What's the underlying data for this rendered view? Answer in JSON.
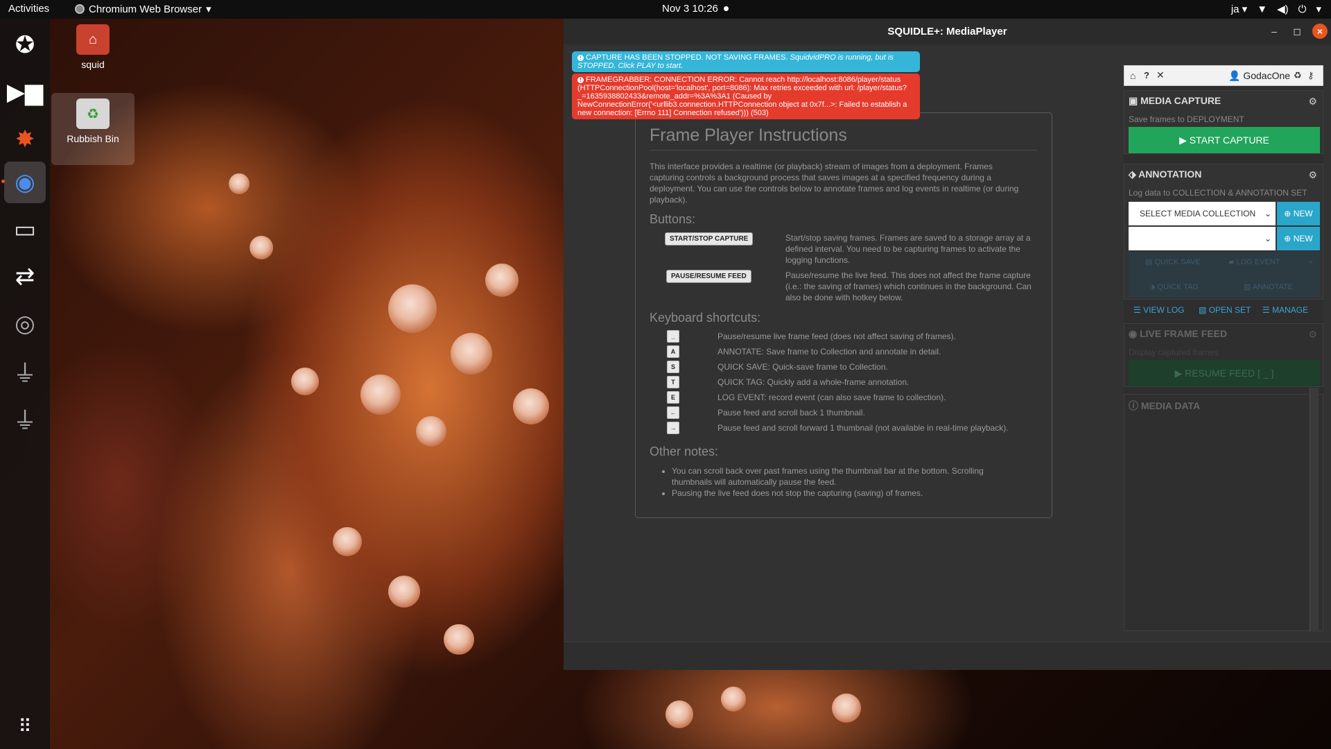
{
  "topbar": {
    "activities": "Activities",
    "app_name": "Chromium Web Browser",
    "clock": "Nov 3  10:26",
    "lang": "ja"
  },
  "desktop": {
    "icons": [
      {
        "label": "squid"
      },
      {
        "label": "Rubbish Bin"
      }
    ]
  },
  "window": {
    "title": "SQUIDLE+: MediaPlayer"
  },
  "alerts": {
    "info_main": "CAPTURE HAS BEEN STOPPED. NOT SAVING FRAMES.",
    "info_italic": "SquidvidPRO is running, but is STOPPED. Click PLAY to start.",
    "danger_text": "FRAMEGRABBER: CONNECTION ERROR: Cannot reach http://localhost:8086/player/status (HTTPConnectionPool(host='localhost', port=8086): Max retries exceeded with url: /player/status?_=1635938802433&remote_addr=%3A%3A1 (Caused by NewConnectionError('<urllib3.connection.HTTPConnection object at 0x7f...>: Failed to establish a new connection: [Errno 111] Connection refused'))) (503)"
  },
  "instructions": {
    "title": "Frame Player Instructions",
    "intro": "This interface provides a realtime (or playback) stream of images from a deployment. Frames capturing controls a background process that saves images at a specified frequency during a deployment. You can use the controls below to annotate frames and log events in realtime (or during playback).",
    "buttons_heading": "Buttons:",
    "buttons": [
      {
        "label": "START/STOP CAPTURE",
        "desc": "Start/stop saving frames. Frames are saved to a storage array at a defined interval. You need to be capturing frames to activate the logging functions."
      },
      {
        "label": "PAUSE/RESUME FEED",
        "desc": "Pause/resume the live feed. This does not affect the frame capture (i.e.: the saving of frames) which continues in the background. Can also be done with hotkey below."
      }
    ],
    "shortcuts_heading": "Keyboard shortcuts:",
    "shortcuts": [
      {
        "key": "_",
        "desc": "Pause/resume live frame feed (does not affect saving of frames)."
      },
      {
        "key": "A",
        "desc": "ANNOTATE: Save frame to Collection and annotate in detail."
      },
      {
        "key": "S",
        "desc": "QUICK SAVE: Quick-save frame to Collection."
      },
      {
        "key": "T",
        "desc": "QUICK TAG: Quickly add a whole-frame annotation."
      },
      {
        "key": "E",
        "desc": "LOG EVENT: record event (can also save frame to collection)."
      },
      {
        "key": "←",
        "desc": "Pause feed and scroll back 1 thumbnail."
      },
      {
        "key": "→",
        "desc": "Pause feed and scroll forward 1 thumbnail (not available in real-time playback)."
      }
    ],
    "notes_heading": "Other notes:",
    "notes": [
      "You can scroll back over past frames using the thumbnail bar at the bottom. Scrolling thumbnails will automatically pause the feed.",
      "Pausing the live feed does not stop the capturing (saving) of frames."
    ]
  },
  "sidebar": {
    "user": "GodacOne",
    "media_capture": {
      "title": "MEDIA CAPTURE",
      "subtitle": "Save frames to DEPLOYMENT",
      "start_button": "START CAPTURE"
    },
    "annotation": {
      "title": "ANNOTATION",
      "subtitle": "Log data to COLLECTION & ANNOTATION SET",
      "collection_select": "SELECT MEDIA COLLECTION",
      "annotation_select": "",
      "new_label": "NEW",
      "quick_save": "QUICK SAVE",
      "log_event": "LOG EVENT",
      "quick_tag": "QUICK TAG",
      "annotate": "ANNOTATE",
      "view_log": "VIEW LOG",
      "open_set": "OPEN SET",
      "manage": "MANAGE"
    },
    "live_feed": {
      "title": "LIVE FRAME FEED",
      "subtitle": "Display captured frames",
      "resume_button": "RESUME FEED [ _ ]"
    },
    "media_data": {
      "title": "MEDIA DATA"
    }
  },
  "colors": {
    "accent_green": "#21a55b",
    "accent_blue": "#2ba6cb",
    "alert_info": "#35b6d9",
    "alert_danger": "#e53b2d",
    "ubuntu_orange": "#e95420"
  }
}
